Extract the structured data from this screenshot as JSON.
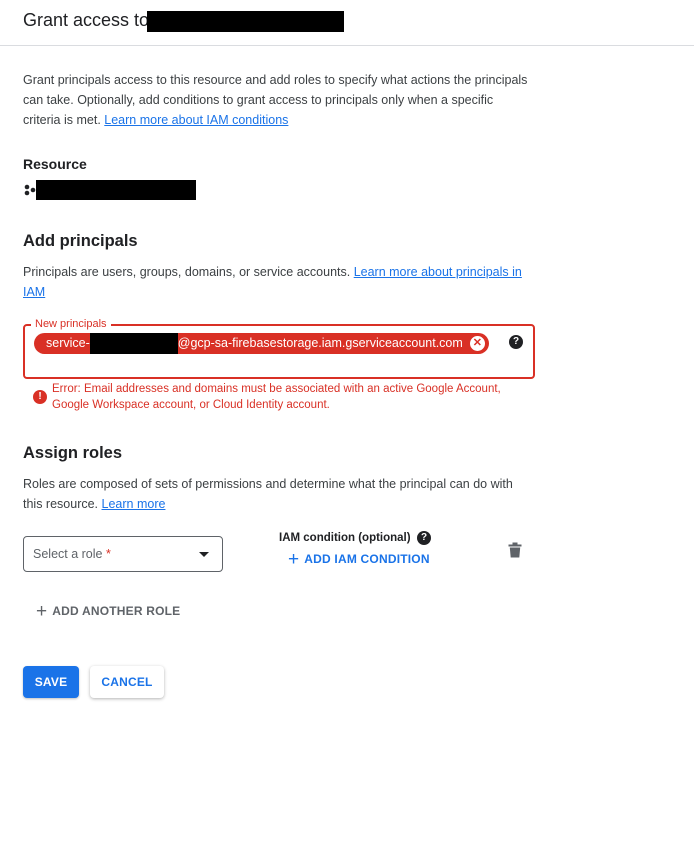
{
  "header": {
    "title": "Grant access to"
  },
  "intro": {
    "text": "Grant principals access to this resource and add roles to specify what actions the principals can take. Optionally, add conditions to grant access to principals only when a specific criteria is met. ",
    "link": "Learn more about IAM conditions"
  },
  "resource": {
    "label": "Resource",
    "icon": "resource-cluster-icon"
  },
  "principals": {
    "title": "Add principals",
    "description": "Principals are users, groups, domains, or service accounts. ",
    "link": "Learn more about principals in IAM",
    "field_label": "New principals",
    "chip_prefix": "service-",
    "chip_suffix": "@gcp-sa-firebasestorage.iam.gserviceaccount.com",
    "error": "Error: Email addresses and domains must be associated with an active Google Account, Google Workspace account, or Cloud Identity account."
  },
  "roles": {
    "title": "Assign roles",
    "description": "Roles are composed of sets of permissions and determine what the principal can do with this resource. ",
    "link": "Learn more",
    "select_placeholder": "Select a role",
    "required_marker": "*",
    "iam_condition_label": "IAM condition (optional)",
    "add_iam_condition": "ADD IAM CONDITION",
    "add_another_role": "ADD ANOTHER ROLE"
  },
  "actions": {
    "save": "SAVE",
    "cancel": "CANCEL"
  },
  "colors": {
    "primary": "#1a73e8",
    "error": "#d93025",
    "text": "#202124"
  }
}
